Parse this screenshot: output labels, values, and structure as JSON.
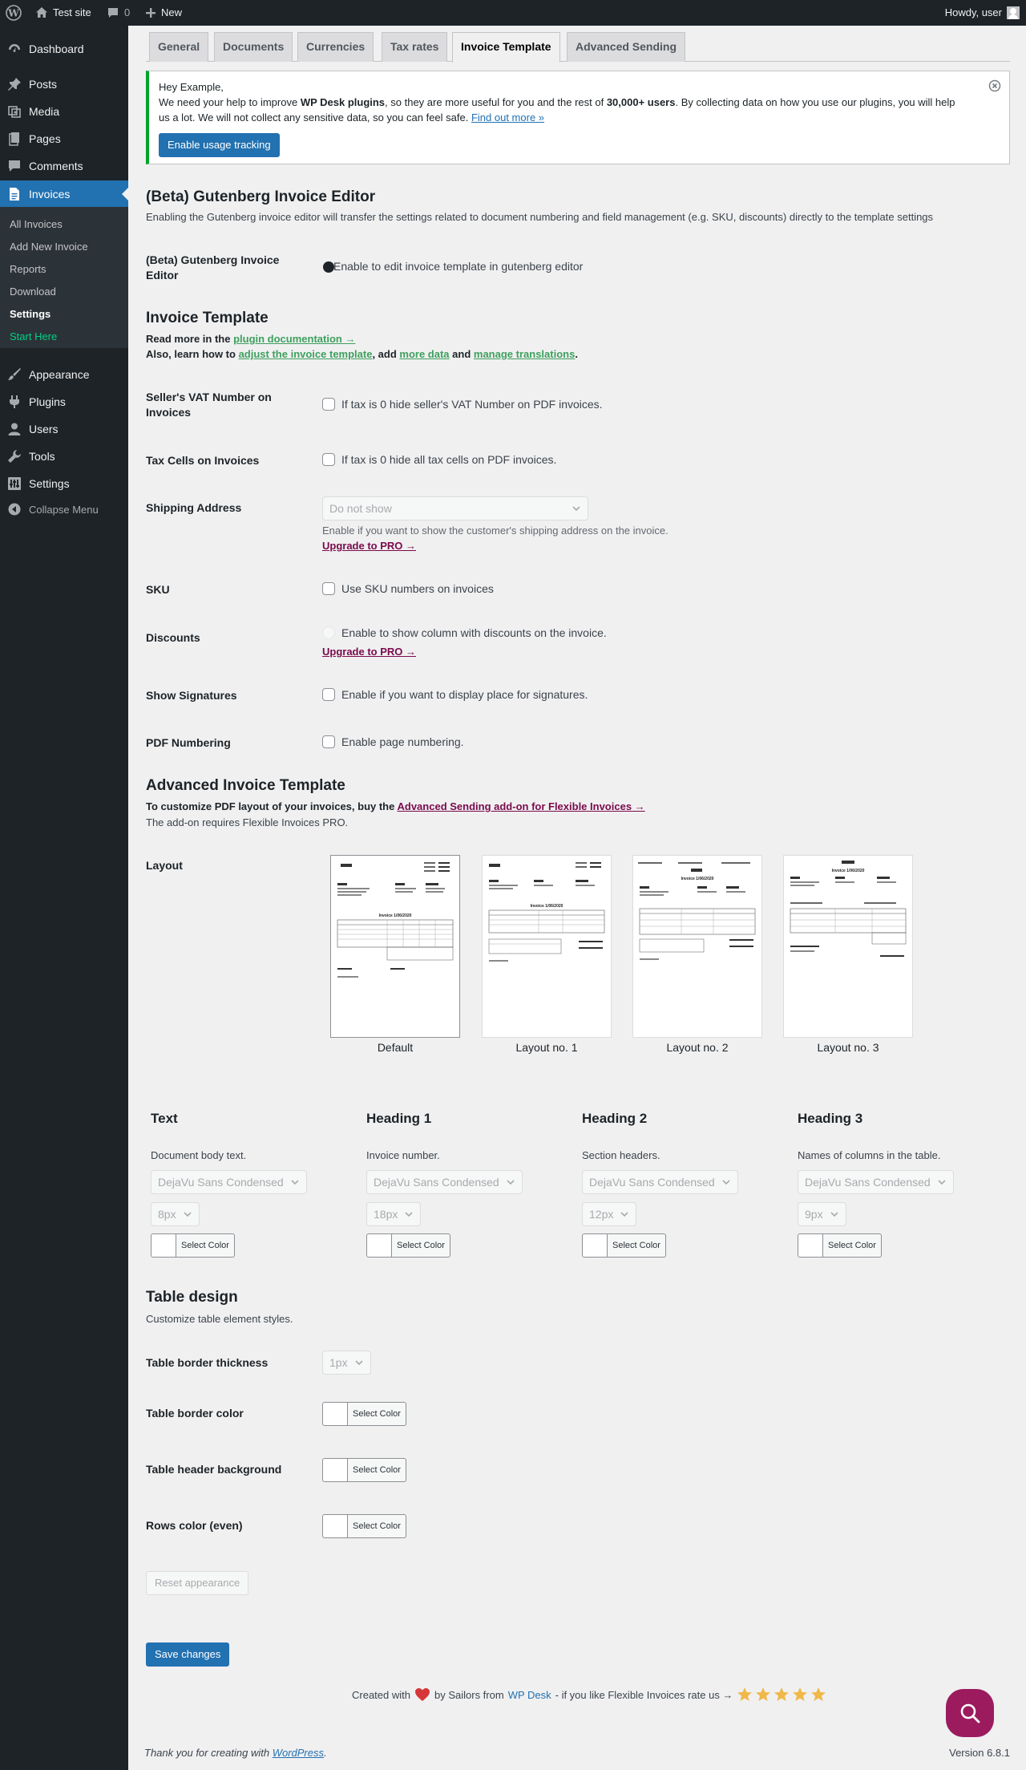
{
  "adminbar": {
    "site_name": "Test site",
    "comments_count": "0",
    "new_label": "New",
    "howdy": "Howdy, user"
  },
  "sidebar": {
    "items": [
      {
        "label": "Dashboard",
        "icon": "dashboard-icon"
      },
      {
        "label": "Posts",
        "icon": "pin-icon"
      },
      {
        "label": "Media",
        "icon": "media-icon"
      },
      {
        "label": "Pages",
        "icon": "pages-icon"
      },
      {
        "label": "Comments",
        "icon": "comment-icon"
      },
      {
        "label": "Invoices",
        "icon": "document-icon"
      },
      {
        "label": "Appearance",
        "icon": "brush-icon"
      },
      {
        "label": "Plugins",
        "icon": "plug-icon"
      },
      {
        "label": "Users",
        "icon": "user-icon"
      },
      {
        "label": "Tools",
        "icon": "wrench-icon"
      },
      {
        "label": "Settings",
        "icon": "settings-icon"
      }
    ],
    "submenu": [
      "All Invoices",
      "Add New Invoice",
      "Reports",
      "Download",
      "Settings",
      "Start Here"
    ],
    "collapse": "Collapse Menu"
  },
  "tabs": [
    "General",
    "Documents",
    "Currencies",
    "Tax rates",
    "Invoice Template",
    "Advanced Sending"
  ],
  "notice": {
    "greeting": "Hey Example,",
    "text_1": "We need your help to improve ",
    "bold_1": "WP Desk plugins",
    "text_2": ", so they are more useful for you and the rest of ",
    "bold_2": "30,000+ users",
    "text_3": ". By collecting data on how you use our plugins, you will help us a lot. We will not collect any sensitive data, so you can feel safe. ",
    "link": "Find out more »",
    "button": "Enable usage tracking"
  },
  "gutenberg": {
    "title": "(Beta) Gutenberg Invoice Editor",
    "desc": "Enabling the Gutenberg invoice editor will transfer the settings related to document numbering and field management (e.g. SKU, discounts) directly to the template settings",
    "label": "(Beta) Gutenberg Invoice Editor",
    "option": "Enable to edit invoice template in gutenberg editor"
  },
  "invoice_template": {
    "title": "Invoice Template",
    "read_more": "Read more in the ",
    "doc_link": "plugin documentation →",
    "learn_1": "Also, learn how to ",
    "adjust_link": "adjust the invoice template",
    "learn_2": ", add ",
    "more_data_link": "more data",
    "learn_3": " and ",
    "translations_link": "manage translations",
    "learn_4": ".",
    "vat_label": "Seller's VAT Number on Invoices",
    "vat_option": "If tax is 0 hide seller's VAT Number on PDF invoices.",
    "tax_label": "Tax Cells on Invoices",
    "tax_option": "If tax is 0 hide all tax cells on PDF invoices.",
    "shipping_label": "Shipping Address",
    "shipping_value": "Do not show",
    "shipping_desc": "Enable if you want to show the customer's shipping address on the invoice.",
    "upgrade": "Upgrade to PRO →",
    "sku_label": "SKU",
    "sku_option": "Use SKU numbers on invoices",
    "discounts_label": "Discounts",
    "discounts_option": "Enable to show column with discounts on the invoice.",
    "signatures_label": "Show Signatures",
    "signatures_option": "Enable if you want to display place for signatures.",
    "numbering_label": "PDF Numbering",
    "numbering_option": "Enable page numbering."
  },
  "advanced": {
    "title": "Advanced Invoice Template",
    "buy_text": "To customize PDF layout of your invoices, buy the ",
    "buy_link": "Advanced Sending add-on for Flexible Invoices →",
    "requires": "The add-on requires Flexible Invoices PRO.",
    "layout_label": "Layout",
    "layouts": [
      "Default",
      "Layout no. 1",
      "Layout no. 2",
      "Layout no. 3"
    ],
    "invoice_no": "Invoice 1/06/2020"
  },
  "fonts": [
    {
      "title": "Text",
      "desc": "Document body text.",
      "font": "DejaVu Sans Condensed",
      "size": "8px"
    },
    {
      "title": "Heading 1",
      "desc": "Invoice number.",
      "font": "DejaVu Sans Condensed",
      "size": "18px"
    },
    {
      "title": "Heading 2",
      "desc": "Section headers.",
      "font": "DejaVu Sans Condensed",
      "size": "12px"
    },
    {
      "title": "Heading 3",
      "desc": "Names of columns in the table.",
      "font": "DejaVu Sans Condensed",
      "size": "9px"
    }
  ],
  "select_color": "Select Color",
  "table_design": {
    "title": "Table design",
    "desc": "Customize table element styles.",
    "border_thickness_label": "Table border thickness",
    "border_thickness_value": "1px",
    "border_color_label": "Table border color",
    "header_bg_label": "Table header background",
    "rows_color_label": "Rows color (even)"
  },
  "reset_button": "Reset appearance",
  "save_button": "Save changes",
  "rate": {
    "created_with": "Created with",
    "by_sailors": "by Sailors from",
    "wpdesk": "WP Desk",
    "rate_text": "- if you like Flexible Invoices rate us →",
    "stars": 5
  },
  "footer": {
    "thanks": "Thank you for creating with ",
    "wordpress": "WordPress",
    "period": ".",
    "version": "Version 6.8.1"
  },
  "colors": {
    "sidebar_bg": "#1d2327",
    "accent": "#2271b1",
    "notice_border": "#00a32a",
    "pro_link": "#7a0a4c",
    "green_link": "#3ea05d",
    "start_here": "#00d084",
    "help_button": "#9b1b5e",
    "star": "#f0b849",
    "heart": "#d63638"
  }
}
